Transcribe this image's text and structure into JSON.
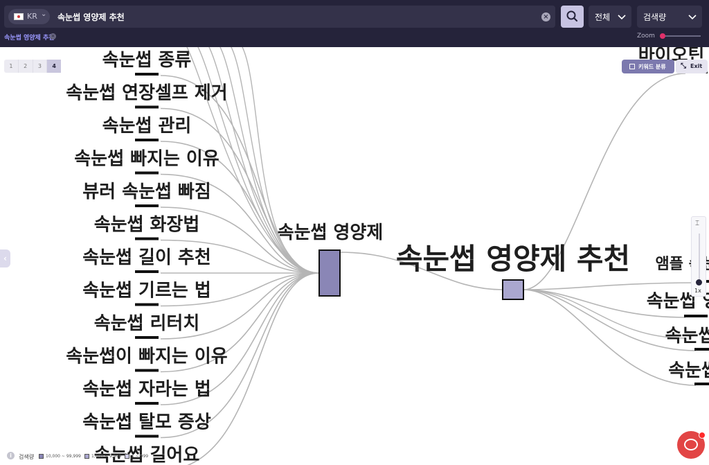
{
  "header": {
    "country_code": "KR",
    "query": "속눈썹 영양제 추천",
    "filter_scope": "전체",
    "filter_metric": "검색량"
  },
  "breadcrumb": {
    "label": "속눈썹 영양제 추천"
  },
  "zoom": {
    "label": "Zoom",
    "level_text": "1x"
  },
  "levels": [
    "1",
    "2",
    "3",
    "4"
  ],
  "active_level": "4",
  "buttons": {
    "keyword_classify": "키워드 분류",
    "exit": "Exit"
  },
  "graph": {
    "root": "속눈썹 영양제 추천",
    "hub": "속눈썹 영양제",
    "left_leaves": [
      "속눈썹 종류",
      "속눈썹 연장셀프 제거",
      "속눈썹 관리",
      "속눈썹 빠지는 이유",
      "뷰러 속눈썹 빠짐",
      "속눈썹 화장법",
      "속눈썹 길이 추천",
      "속눈썹 기르는 법",
      "속눈썹 리터치",
      "속눈썹이 빠지는 이유",
      "속눈썹 자라는 법",
      "속눈썹 탈모 증상",
      "속눈썹 길어요"
    ],
    "right_leaves": [
      "바이오틴 속눈썹",
      "앰플 속눈썹 영양",
      "속눈썹 영양제",
      "속눈썹 영양",
      "속눈썹영양"
    ]
  },
  "legend": {
    "title": "검색량",
    "items": [
      {
        "label": "10,000 ~ 99,999",
        "color": "#8a86b6"
      },
      {
        "label": "1,000 ~ 9,999",
        "color": "#aaa7cf"
      },
      {
        "label": "1 ~ 999",
        "color": "#cfcde6"
      }
    ]
  },
  "colors": {
    "topbar": "#25233a",
    "accent": "#9b98ff",
    "hub_node": "#8a86b6",
    "root_node": "#aaa7cf",
    "edge": "#b5b5b5",
    "chat": "#e24545"
  },
  "icons": {
    "search": "search-icon",
    "clear": "clear-icon",
    "chevron": "chevron-down-icon",
    "chat": "chat-icon"
  }
}
